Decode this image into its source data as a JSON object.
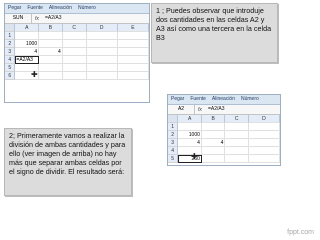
{
  "callout1": {
    "text": "1 ; Puedes observar que introduje dos cantidades en las celdas A2 y A3 así como una tercera en la celda B3"
  },
  "callout2": {
    "text": "2; Primeramente vamos a realizar la división de ambas cantidades y para ello (ver imagen de arriba) no hay más que separar ambas celdas por el signo de dividir. El resultado será:"
  },
  "excel1": {
    "ribbon": [
      "Pegar",
      "Fuente",
      "Alineación",
      "Número"
    ],
    "name_box": "SUN",
    "fx": "fx",
    "formula": "=A2/A3",
    "columns": [
      "A",
      "B",
      "C",
      "D",
      "E"
    ],
    "rows": [
      {
        "n": "1",
        "cells": [
          "",
          "",
          "",
          "",
          ""
        ]
      },
      {
        "n": "2",
        "cells": [
          "1000",
          "",
          "",
          "",
          ""
        ]
      },
      {
        "n": "3",
        "cells": [
          "4",
          "4",
          "",
          "",
          ""
        ]
      },
      {
        "n": "4",
        "cells": [
          "=A2/A3",
          "",
          "",
          "",
          ""
        ]
      },
      {
        "n": "5",
        "cells": [
          "",
          "",
          "",
          "",
          ""
        ]
      },
      {
        "n": "6",
        "cells": [
          "",
          "",
          "",
          "",
          ""
        ]
      }
    ]
  },
  "excel2": {
    "ribbon": [
      "Pegar",
      "Fuente",
      "Alineación",
      "Número"
    ],
    "name_box": "A2",
    "fx": "fx",
    "formula": "=A2/A3",
    "columns": [
      "A",
      "B",
      "C",
      "D"
    ],
    "rows": [
      {
        "n": "1",
        "cells": [
          "",
          "",
          "",
          ""
        ]
      },
      {
        "n": "2",
        "cells": [
          "1000",
          "",
          "",
          ""
        ]
      },
      {
        "n": "3",
        "cells": [
          "4",
          "4",
          "",
          ""
        ]
      },
      {
        "n": "4",
        "cells": [
          "",
          "",
          "",
          ""
        ]
      },
      {
        "n": "5",
        "cells": [
          "250",
          "",
          "",
          ""
        ]
      }
    ]
  },
  "footer": {
    "text": "fppt.com"
  }
}
